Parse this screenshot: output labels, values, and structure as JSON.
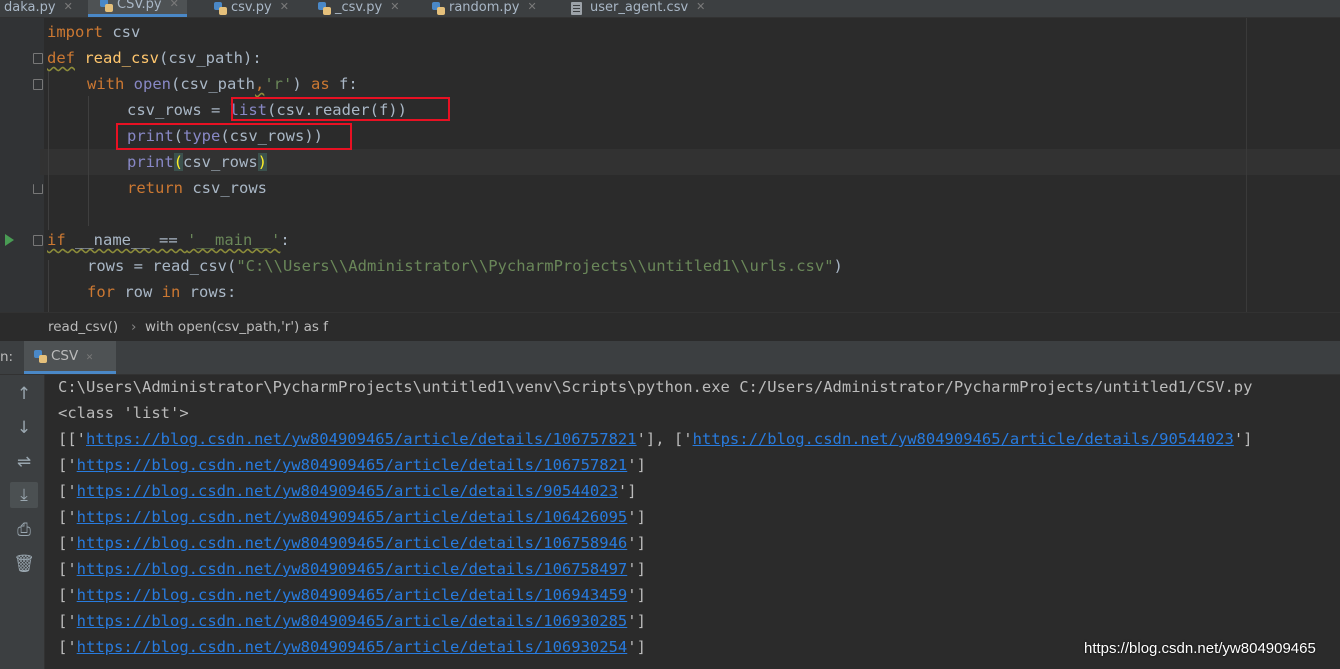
{
  "tabs": [
    {
      "label": "daka.py",
      "icon": "python-file-icon"
    },
    {
      "label": "CSV.py",
      "icon": "python-file-icon",
      "active": true
    },
    {
      "label": "csv.py",
      "icon": "python-file-icon"
    },
    {
      "label": "_csv.py",
      "icon": "python-file-icon"
    },
    {
      "label": "random.py",
      "icon": "python-file-icon"
    },
    {
      "label": "user_agent.csv",
      "icon": "csv-file-icon"
    }
  ],
  "tab_close_glyph": "✕",
  "editor": {
    "code": {
      "l1_kw": "import",
      "l1_rest": " csv",
      "l2_kw": "def",
      "l2_fn": "read_csv",
      "l2_rest": "(csv_path):",
      "l3_kw": "with",
      "l3_open": "open",
      "l3_a": "(csv_path",
      "l3_comma": ",",
      "l3_str": "'r'",
      "l3_b": ") ",
      "l3_as": "as",
      "l3_c": " f:",
      "l4_a": "csv_rows = ",
      "l4_list": "list",
      "l4_b": "(csv.reader(f))",
      "l5_print": "print",
      "l5_type": "type",
      "l5_b": "(csv_rows))",
      "l5_a": "(",
      "l6_print": "print",
      "l6_p1": "(",
      "l6_mid": "csv_rows",
      "l6_p2": ")",
      "l7_kw": "return",
      "l7_rest": " csv_rows",
      "l9_kw": "if",
      "l9_a": " __name__ == ",
      "l9_str": "'__main__'",
      "l9_b": ":",
      "l10_a": "rows = read_csv(",
      "l10_str": "\"C:\\\\Users\\\\Administrator\\\\PycharmProjects\\\\untitled1\\\\urls.csv\"",
      "l10_b": ")",
      "l11_for": "for",
      "l11_a": " row ",
      "l11_in": "in",
      "l11_b": " rows:"
    }
  },
  "breadcrumb": {
    "item1": "read_csv()",
    "sep": "›",
    "item2": "with open(csv_path,'r') as f"
  },
  "run_panel": {
    "label": "n:",
    "tab_label": "CSV",
    "tools": [
      "up-arrow-icon",
      "down-arrow-icon",
      "soft-wrap-icon",
      "scroll-to-end-icon",
      "print-icon",
      "trash-icon"
    ],
    "output": {
      "cmd": "C:\\Users\\Administrator\\PycharmProjects\\untitled1\\venv\\Scripts\\python.exe C:/Users/Administrator/PycharmProjects/untitled1/CSV.py",
      "class_line": "<class 'list'>",
      "first_line": {
        "pre": "[['",
        "url1": "https://blog.csdn.net/yw804909465/article/details/106757821",
        "mid": "'], ['",
        "url2": "https://blog.csdn.net/yw804909465/article/details/90544023",
        "post": "']"
      },
      "rows": [
        "https://blog.csdn.net/yw804909465/article/details/106757821",
        "https://blog.csdn.net/yw804909465/article/details/90544023",
        "https://blog.csdn.net/yw804909465/article/details/106426095",
        "https://blog.csdn.net/yw804909465/article/details/106758946",
        "https://blog.csdn.net/yw804909465/article/details/106758497",
        "https://blog.csdn.net/yw804909465/article/details/106943459",
        "https://blog.csdn.net/yw804909465/article/details/106930285",
        "https://blog.csdn.net/yw804909465/article/details/106930254"
      ],
      "row_pre": "['",
      "row_post": "']"
    }
  },
  "watermark": "https://blog.csdn.net/yw804909465",
  "colors": {
    "keyword": "#cc7832",
    "function": "#ffc66d",
    "string": "#6a8759",
    "builtin": "#8888c6",
    "link": "#287bde",
    "highlight_box": "#e81123"
  }
}
